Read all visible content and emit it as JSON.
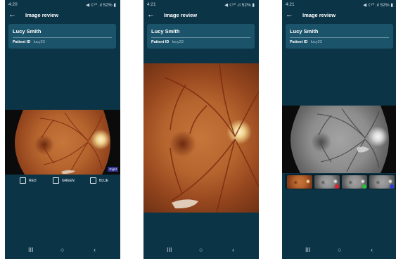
{
  "screens": [
    {
      "status": {
        "time": "4:20",
        "icons": "◀ ☇⁵⁰ .ıl 52% ▮"
      },
      "appbar": {
        "title": "Image review",
        "back_icon": "←"
      },
      "patient": {
        "name": "Lucy Smith",
        "id_label": "Patient ID",
        "id_value": "lucy23"
      },
      "eye_tag": "Right",
      "rgb_options": [
        {
          "label": "RED",
          "checked": false
        },
        {
          "label": "GREEN",
          "checked": false
        },
        {
          "label": "BLUE",
          "checked": false
        }
      ],
      "nav": {
        "recents": "III",
        "home": "○",
        "back": "‹"
      }
    },
    {
      "status": {
        "time": "4:21",
        "icons": "◀ ☇⁵⁰ .ıl 52% ▮"
      },
      "appbar": {
        "title": "Image review",
        "back_icon": "←"
      },
      "patient": {
        "name": "Lucy Smith",
        "id_label": "Patient ID",
        "id_value": "lucy23"
      },
      "nav": {
        "recents": "III",
        "home": "○",
        "back": "‹"
      }
    },
    {
      "status": {
        "time": "4:21",
        "icons": "◀ ☇⁵⁰ .ıl 52% ▮"
      },
      "appbar": {
        "title": "Image review",
        "back_icon": "←"
      },
      "patient": {
        "name": "Lucy Smith",
        "id_label": "Patient ID",
        "id_value": "lucy23"
      },
      "thumbnails": [
        {
          "kind": "color",
          "dot": null
        },
        {
          "kind": "gray",
          "dot": "#e0202a"
        },
        {
          "kind": "gray",
          "dot": "#22c23a"
        },
        {
          "kind": "gray",
          "dot": "#2a3fd8"
        }
      ],
      "nav": {
        "recents": "III",
        "home": "○",
        "back": "‹"
      }
    }
  ],
  "colors": {
    "background": "#0b3446",
    "card": "#1b536b",
    "eye_tag": "#2f2f8c"
  }
}
